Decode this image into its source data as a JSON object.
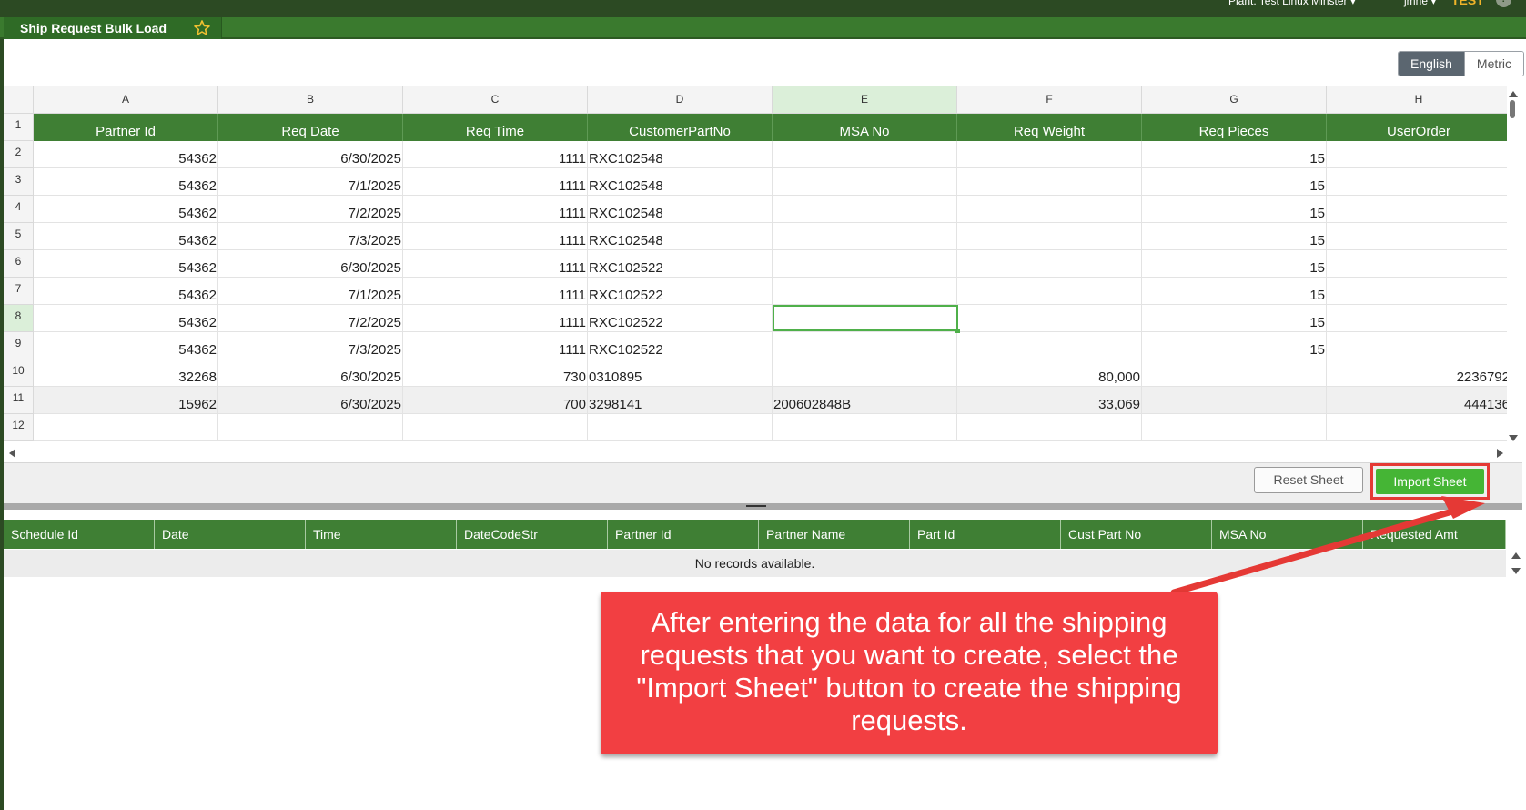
{
  "topbar": {
    "plant": "Plant: Test Linux Minster ▾",
    "user": "jmne ▾",
    "env": "TEST",
    "help": "?"
  },
  "tab": {
    "title": "Ship Request Bulk Load",
    "star_icon": "star-outline-icon"
  },
  "units": {
    "english": "English",
    "metric": "Metric",
    "selected": "English"
  },
  "sheet": {
    "column_letters": [
      "A",
      "B",
      "C",
      "D",
      "E",
      "F",
      "G",
      "H"
    ],
    "row_numbers": [
      "1",
      "2",
      "3",
      "4",
      "5",
      "6",
      "7",
      "8",
      "9",
      "10",
      "11",
      "12"
    ],
    "headers": [
      "Partner Id",
      "Req Date",
      "Req Time",
      "CustomerPartNo",
      "MSA No",
      "Req Weight",
      "Req Pieces",
      "UserOrder"
    ],
    "rows": [
      [
        "54362",
        "6/30/2025",
        "1111",
        "RXC102548",
        "",
        "",
        "15",
        ""
      ],
      [
        "54362",
        "7/1/2025",
        "1111",
        "RXC102548",
        "",
        "",
        "15",
        ""
      ],
      [
        "54362",
        "7/2/2025",
        "1111",
        "RXC102548",
        "",
        "",
        "15",
        ""
      ],
      [
        "54362",
        "7/3/2025",
        "1111",
        "RXC102548",
        "",
        "",
        "15",
        ""
      ],
      [
        "54362",
        "6/30/2025",
        "1111",
        "RXC102522",
        "",
        "",
        "15",
        ""
      ],
      [
        "54362",
        "7/1/2025",
        "1111",
        "RXC102522",
        "",
        "",
        "15",
        ""
      ],
      [
        "54362",
        "7/2/2025",
        "1111",
        "RXC102522",
        "",
        "",
        "15",
        ""
      ],
      [
        "54362",
        "7/3/2025",
        "1111",
        "RXC102522",
        "",
        "",
        "15",
        ""
      ],
      [
        "32268",
        "6/30/2025",
        "730",
        "0310895",
        "",
        "80,000",
        "",
        "2236792"
      ],
      [
        "15962",
        "6/30/2025",
        "700",
        "3298141",
        "200602848B",
        "33,069",
        "",
        "444136"
      ],
      [
        "",
        "",
        "",
        "",
        "",
        "",
        "",
        ""
      ]
    ]
  },
  "buttons": {
    "reset": "Reset Sheet",
    "import": "Import Sheet"
  },
  "grid": {
    "columns": [
      "Schedule Id",
      "Date",
      "Time",
      "DateCodeStr",
      "Partner Id",
      "Partner Name",
      "Part Id",
      "Cust Part No",
      "MSA No",
      "Requested Amt"
    ],
    "empty_message": "No records available."
  },
  "callout": {
    "text": "After entering the data for all the shipping requests that you want to create, select the \"Import Sheet\" button to create the shipping requests.",
    "color": "#f23f42"
  },
  "colors": {
    "brand_dark": "#2c4a23",
    "brand": "#3f7f34",
    "accent_green": "#45b535",
    "highlight_red": "#e53935"
  }
}
